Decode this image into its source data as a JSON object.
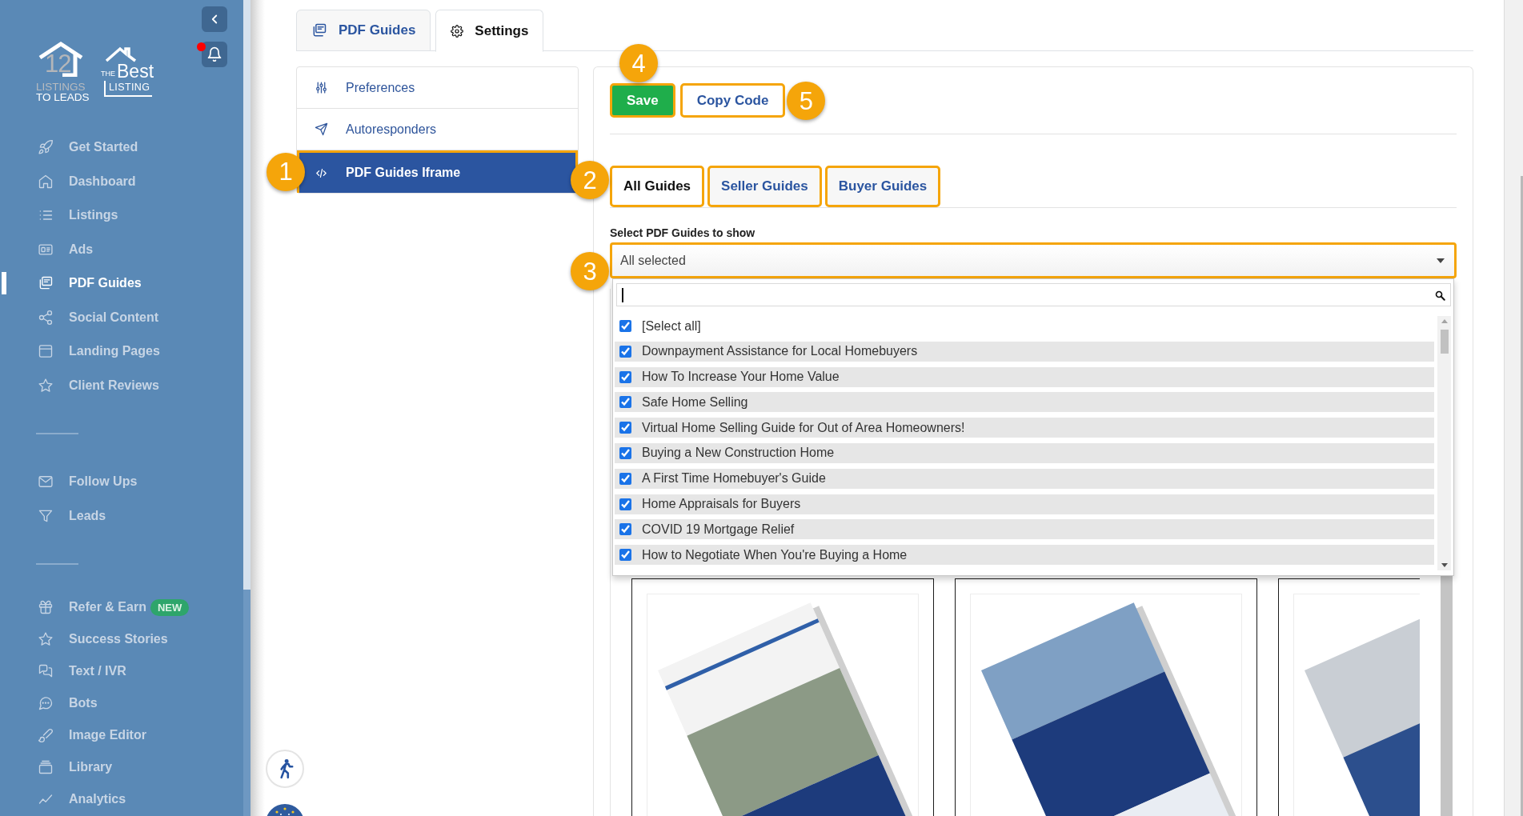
{
  "sidebar": {
    "logo_primary": {
      "number": "12",
      "line_1": "LISTINGS",
      "line_2": "TO LEADS"
    },
    "logo_secondary": {
      "prefix": "THE",
      "word": "Best",
      "line_2": "LISTING"
    },
    "notifications": {
      "unread": true
    },
    "sections": [
      {
        "items": [
          {
            "label": "Get Started",
            "selected": false
          },
          {
            "label": "Dashboard",
            "selected": false
          },
          {
            "label": "Listings",
            "selected": false
          },
          {
            "label": "Ads",
            "selected": false
          },
          {
            "label": "PDF Guides",
            "selected": true
          },
          {
            "label": "Social Content",
            "selected": false
          },
          {
            "label": "Landing Pages",
            "selected": false
          },
          {
            "label": "Client Reviews",
            "selected": false
          }
        ]
      },
      {
        "items": [
          {
            "label": "Follow Ups",
            "selected": false
          },
          {
            "label": "Leads",
            "selected": false
          }
        ]
      },
      {
        "items": [
          {
            "label": "Refer & Earn",
            "selected": false,
            "badge": "NEW"
          },
          {
            "label": "Success Stories",
            "selected": false
          },
          {
            "label": "Text / IVR",
            "selected": false
          },
          {
            "label": "Bots",
            "selected": false
          },
          {
            "label": "Image Editor",
            "selected": false
          },
          {
            "label": "Library",
            "selected": false
          },
          {
            "label": "Analytics",
            "selected": false
          }
        ]
      }
    ]
  },
  "tabs": [
    {
      "label": "PDF Guides",
      "selected": false
    },
    {
      "label": "Settings",
      "selected": true
    }
  ],
  "settings_menu": [
    {
      "label": "Preferences",
      "selected": false,
      "highlighted": false
    },
    {
      "label": "Autoresponders",
      "selected": false,
      "highlighted": false
    },
    {
      "label": "PDF Guides Iframe",
      "selected": true,
      "highlighted": true,
      "callout": "1"
    }
  ],
  "actions": [
    {
      "label": "Save",
      "kind": "primary",
      "highlighted": true,
      "callout": "4"
    },
    {
      "label": "Copy Code",
      "kind": "secondary",
      "highlighted": true,
      "callout": "5"
    }
  ],
  "guide_tabs": [
    {
      "label": "All Guides",
      "selected": true,
      "highlighted": true,
      "callout": "2"
    },
    {
      "label": "Seller Guides",
      "selected": false,
      "highlighted": true
    },
    {
      "label": "Buyer Guides",
      "selected": false,
      "highlighted": true
    }
  ],
  "guide_select": {
    "label": "Select PDF Guides to show",
    "value": "All selected",
    "highlighted": true,
    "callout": "3",
    "expanded": true,
    "options": [
      {
        "label": "[Select all]",
        "kind": "select-all",
        "checked": true
      },
      {
        "label": "Downpayment Assistance for Local Homebuyers",
        "kind": "option",
        "checked": true
      },
      {
        "label": "How To Increase Your Home Value",
        "kind": "option",
        "checked": true
      },
      {
        "label": "Safe Home Selling",
        "kind": "option",
        "checked": true
      },
      {
        "label": "Virtual Home Selling Guide for Out of Area Homeowners!",
        "kind": "option",
        "checked": true
      },
      {
        "label": "Buying a New Construction Home",
        "kind": "option",
        "checked": true
      },
      {
        "label": "A First Time Homebuyer's Guide",
        "kind": "option",
        "checked": true
      },
      {
        "label": "Home Appraisals for Buyers",
        "kind": "option",
        "checked": true
      },
      {
        "label": "COVID 19 Mortgage Relief",
        "kind": "option",
        "checked": true
      },
      {
        "label": "How to Negotiate When You're Buying a Home",
        "kind": "option",
        "checked": true
      }
    ]
  },
  "guide_cards": [
    {
      "clipped": false
    },
    {
      "clipped": false
    },
    {
      "clipped": true
    }
  ]
}
